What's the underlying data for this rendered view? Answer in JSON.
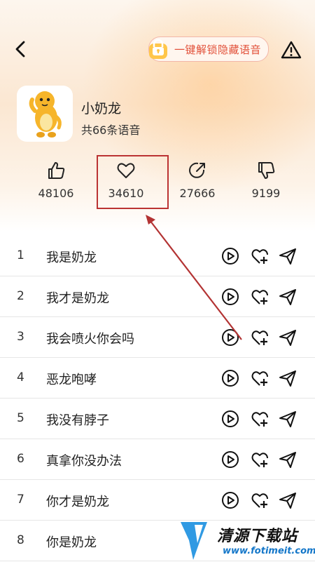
{
  "header": {
    "unlock_label": "一键解锁隐藏语音"
  },
  "pack": {
    "name": "小奶龙",
    "count_text": "共66条语音"
  },
  "stats": {
    "likes": "48106",
    "favorites": "34610",
    "shares": "27666",
    "dislikes": "9199"
  },
  "voices": [
    {
      "index": "1",
      "title": "我是奶龙"
    },
    {
      "index": "2",
      "title": "我才是奶龙"
    },
    {
      "index": "3",
      "title": "我会喷火你会吗"
    },
    {
      "index": "4",
      "title": "恶龙咆哮"
    },
    {
      "index": "5",
      "title": "我没有脖子"
    },
    {
      "index": "6",
      "title": "真拿你没办法"
    },
    {
      "index": "7",
      "title": "你才是奶龙"
    },
    {
      "index": "8",
      "title": "你是奶龙"
    }
  ],
  "watermark": {
    "brand": "清源下载站",
    "url": "www.fotimeit.com"
  },
  "colors": {
    "accent": "#e2513a",
    "annotation": "#b33333",
    "wm_blue": "#1477c9"
  },
  "icons": [
    "back-arrow-icon",
    "lock-icon",
    "warning-icon",
    "thumbs-up-icon",
    "heart-icon",
    "share-icon",
    "thumbs-down-icon",
    "play-icon",
    "heart-plus-icon",
    "send-icon"
  ]
}
